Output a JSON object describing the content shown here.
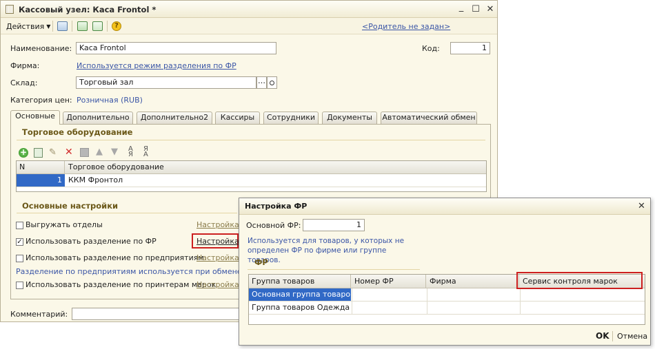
{
  "main": {
    "title": "Кассовый узел: Каса Frontol *",
    "window_buttons": {
      "minimize": "_",
      "maximize": "☐",
      "close": "✕"
    },
    "toolbar": {
      "actions_label": "Действия",
      "parent_link": "<Родитель не задан>"
    },
    "fields": {
      "name_label": "Наименование:",
      "name_value": "Kaca Frontol",
      "code_label": "Код:",
      "code_value": "1",
      "firm_label": "Фирма:",
      "firm_value": "Используется режим разделения по ФР",
      "warehouse_label": "Склад:",
      "warehouse_value": "Торговый зал",
      "price_category_label": "Категория цен:",
      "price_category_value": "Розничная (RUB)",
      "comment_label": "Комментарий:",
      "comment_value": ""
    },
    "tabs": [
      {
        "label": "Основные"
      },
      {
        "label": "Дополнительно"
      },
      {
        "label": "Дополнительно2"
      },
      {
        "label": "Кассиры"
      },
      {
        "label": "Сотрудники"
      },
      {
        "label": "Документы"
      },
      {
        "label": "Автоматический обмен"
      }
    ],
    "equipment": {
      "section_title": "Торговое оборудование",
      "columns": [
        "N",
        "Торговое оборудование"
      ],
      "rows": [
        {
          "n": "1",
          "name": "ККМ Фронтол"
        }
      ]
    },
    "settings": {
      "section_title": "Основные настройки",
      "items": [
        {
          "label": "Выгружать отделы",
          "checked": false,
          "link": "Настройка"
        },
        {
          "label": "Использовать разделение по ФР",
          "checked": true,
          "link": "Настройка"
        },
        {
          "label": "Использовать разделение по предприятиям",
          "checked": false,
          "link": "Настройка"
        },
        {
          "label": "Использовать разделение по принтерам марок",
          "checked": false,
          "link": "Настройка"
        }
      ],
      "note": "Разделение по предприятиям используется при обмене данными"
    }
  },
  "dialog": {
    "title": "Настройка ФР",
    "close_glyph": "✕",
    "main_fr_label": "Основной ФР:",
    "main_fr_value": "1",
    "hint": "Используется для товаров, у которых не определен ФР по фирме или группе товаров.",
    "section_title": "ФР",
    "columns": [
      "Группа товаров",
      "Номер ФР",
      "Фирма",
      "Сервис контроля марок"
    ],
    "rows": [
      {
        "group": "Основная группа товаров",
        "fr": "",
        "firm": "",
        "service": ""
      },
      {
        "group": "Группа товаров Одежда",
        "fr": "",
        "firm": "",
        "service": ""
      }
    ],
    "ok_label": "OK",
    "cancel_label": "Отмена"
  },
  "colors": {
    "highlight_red": "#cc1f1f",
    "selection_blue": "#3169c6",
    "link_blue": "#3a55a6",
    "section_brown": "#6b5818"
  }
}
